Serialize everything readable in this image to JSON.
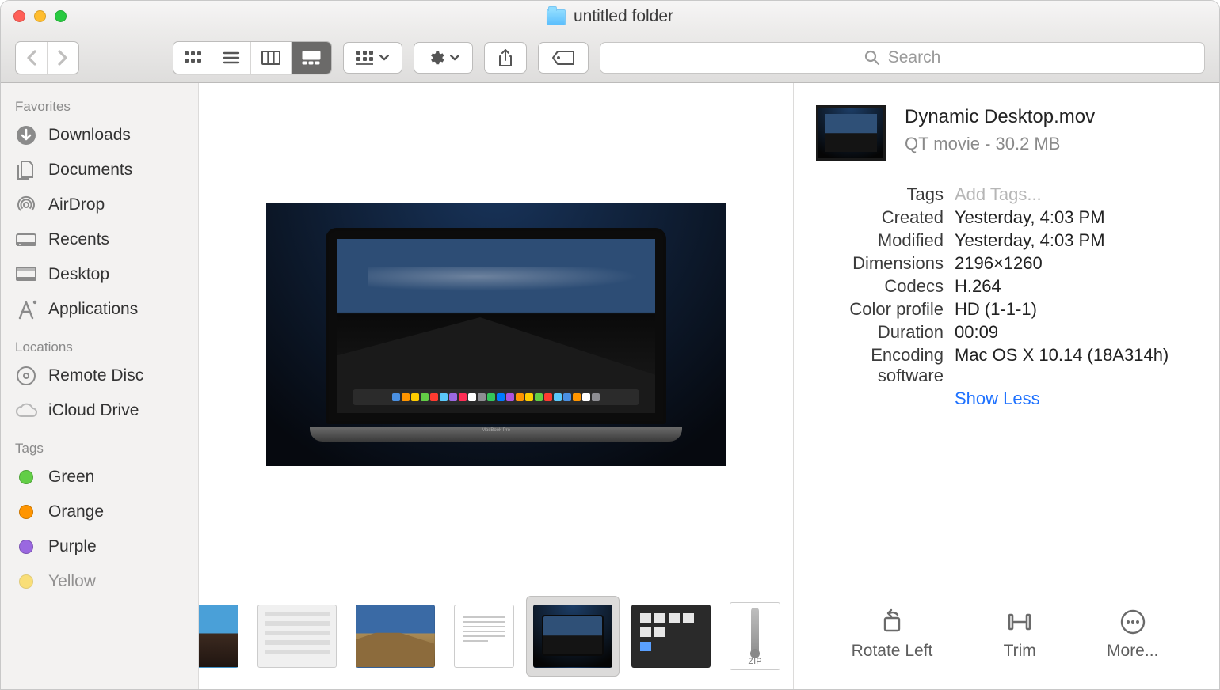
{
  "window": {
    "title": "untitled folder"
  },
  "search": {
    "placeholder": "Search"
  },
  "sidebar": {
    "groups": [
      {
        "label": "Favorites",
        "items": [
          {
            "label": "Downloads",
            "icon": "download-circle"
          },
          {
            "label": "Documents",
            "icon": "documents"
          },
          {
            "label": "AirDrop",
            "icon": "airdrop"
          },
          {
            "label": "Recents",
            "icon": "recents"
          },
          {
            "label": "Desktop",
            "icon": "desktop"
          },
          {
            "label": "Applications",
            "icon": "applications"
          }
        ]
      },
      {
        "label": "Locations",
        "items": [
          {
            "label": "Remote Disc",
            "icon": "disc"
          },
          {
            "label": "iCloud Drive",
            "icon": "cloud"
          }
        ]
      },
      {
        "label": "Tags",
        "items": [
          {
            "label": "Green",
            "color": "#62ce46"
          },
          {
            "label": "Orange",
            "color": "#ff9500"
          },
          {
            "label": "Purple",
            "color": "#9a68e0"
          },
          {
            "label": "Yellow",
            "color": "#ffcc00"
          }
        ]
      }
    ]
  },
  "file": {
    "name": "Dynamic Desktop.mov",
    "kind_size": "QT movie - 30.2 MB",
    "tags_placeholder": "Add Tags...",
    "props": [
      {
        "label": "Tags",
        "value": "",
        "placeholder": true
      },
      {
        "label": "Created",
        "value": "Yesterday, 4:03 PM"
      },
      {
        "label": "Modified",
        "value": "Yesterday, 4:03 PM"
      },
      {
        "label": "Dimensions",
        "value": "2196×1260"
      },
      {
        "label": "Codecs",
        "value": "H.264"
      },
      {
        "label": "Color profile",
        "value": "HD (1-1-1)"
      },
      {
        "label": "Duration",
        "value": "00:09"
      },
      {
        "label": "Encoding software",
        "value": "Mac OS X 10.14 (18A314h)"
      }
    ],
    "show_less": "Show Less"
  },
  "thumb_zip_label": "ZIP",
  "actions": {
    "rotate": "Rotate Left",
    "trim": "Trim",
    "more": "More..."
  },
  "dock_colors": [
    "#4a90e2",
    "#ff9500",
    "#ffcc00",
    "#62ce46",
    "#ff3b30",
    "#5ac8fa",
    "#9a68e0",
    "#ff2d55",
    "#ffffff",
    "#8e8e93",
    "#34c759",
    "#007aff",
    "#af52de",
    "#ff9500",
    "#ffcc00",
    "#62ce46",
    "#ff3b30",
    "#5ac8fa",
    "#4a90e2",
    "#ff9500",
    "#ffffff",
    "#8e8e93"
  ]
}
